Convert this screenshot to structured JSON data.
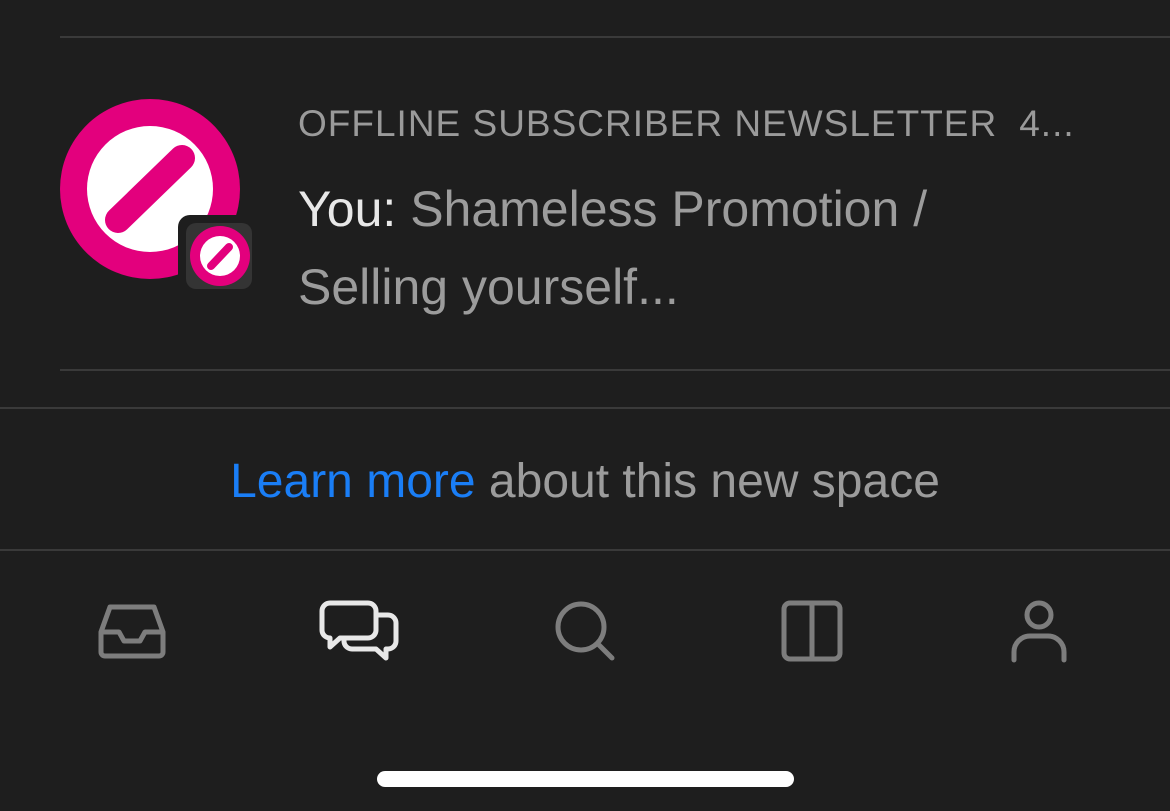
{
  "thread": {
    "space_name": "OFFLINE SUBSCRIBER NEWSLETTER",
    "time": "4...",
    "sender": "You:",
    "preview": "Shameless Promotion / Selling yourself...",
    "avatar_icon": "slash-circle-logo",
    "badge_icon": "slash-circle-logo",
    "brand_color": "#e3007d"
  },
  "info": {
    "link_text": "Learn more",
    "rest_text": "about this new space",
    "link_color": "#1a7ef6"
  },
  "tabbar": {
    "items": [
      {
        "name": "inbox",
        "icon": "inbox-tray-icon",
        "active": false
      },
      {
        "name": "chats",
        "icon": "chat-bubbles-icon",
        "active": true
      },
      {
        "name": "search",
        "icon": "search-icon",
        "active": false
      },
      {
        "name": "spaces",
        "icon": "columns-icon",
        "active": false
      },
      {
        "name": "profile",
        "icon": "person-icon",
        "active": false
      }
    ]
  }
}
